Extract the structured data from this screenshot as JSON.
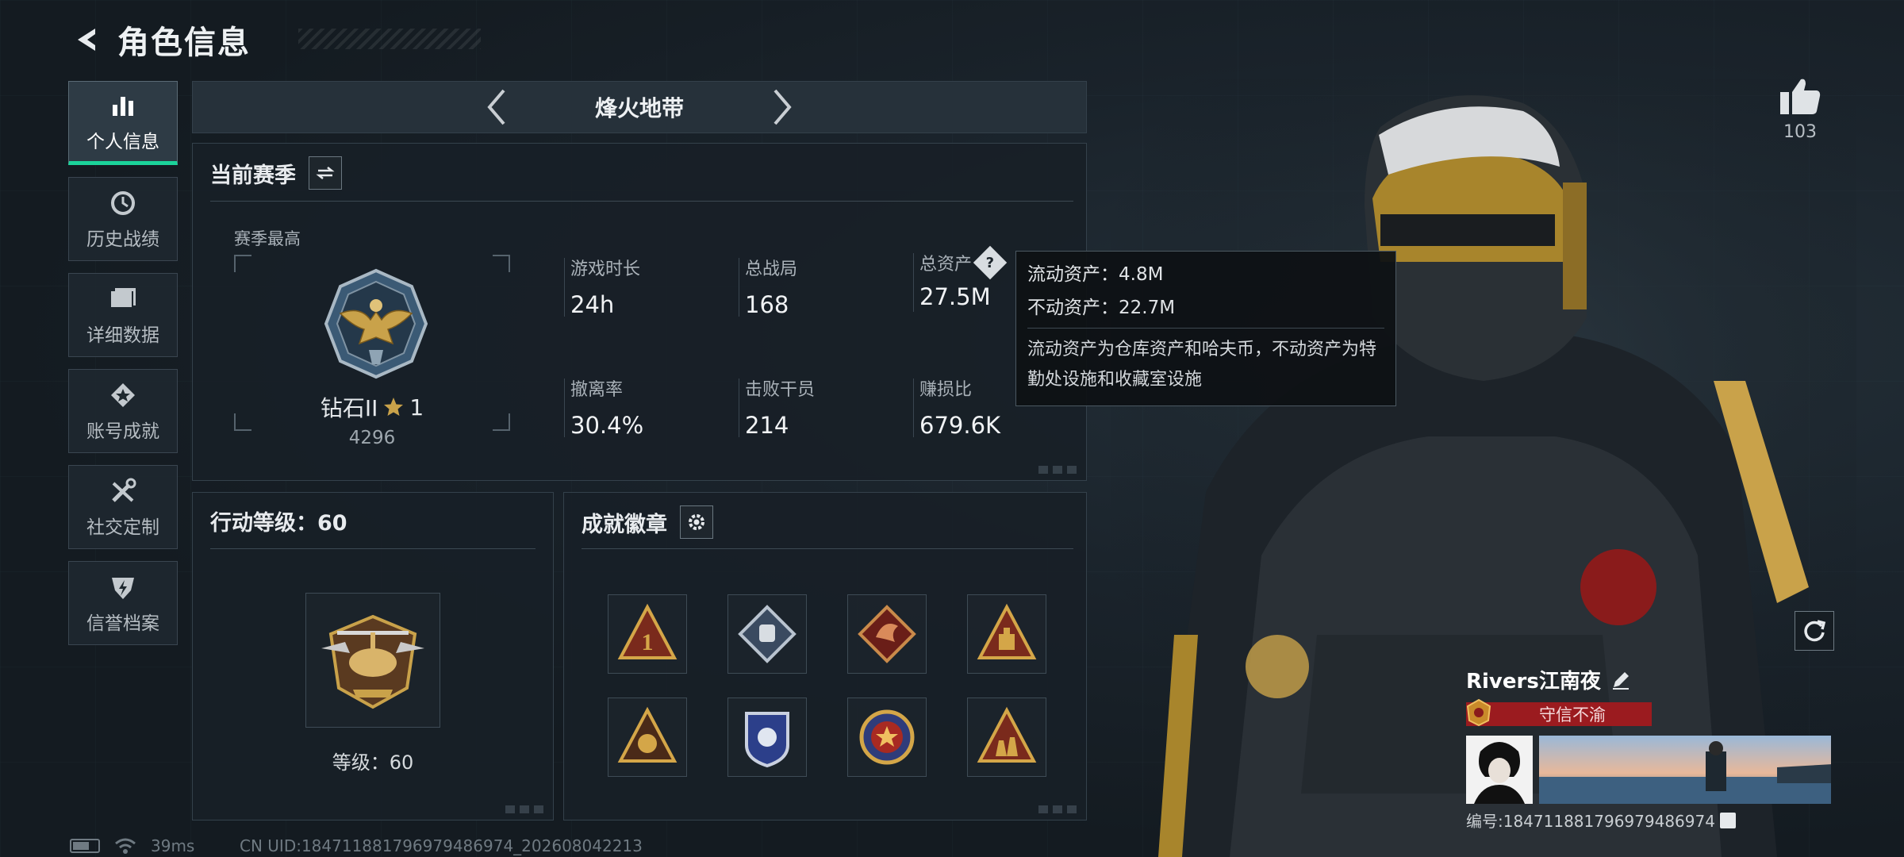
{
  "header": {
    "title": "角色信息"
  },
  "sidebar": {
    "items": [
      {
        "label": "个人信息",
        "icon": "bar-chart-icon",
        "active": true
      },
      {
        "label": "历史战绩",
        "icon": "history-icon"
      },
      {
        "label": "详细数据",
        "icon": "folder-icon"
      },
      {
        "label": "账号成就",
        "icon": "achievement-star-icon"
      },
      {
        "label": "社交定制",
        "icon": "wrench-screwdriver-icon"
      },
      {
        "label": "信誉档案",
        "icon": "shield-emblem-icon"
      }
    ]
  },
  "mode_bar": {
    "label": "烽火地带"
  },
  "season": {
    "title": "当前赛季",
    "best_label": "赛季最高",
    "rank": {
      "name": "钻石II",
      "stars": "1",
      "score": "4296"
    },
    "stats": {
      "play_time": {
        "label": "游戏时长",
        "value": "24h"
      },
      "total_matches": {
        "label": "总战局",
        "value": "168"
      },
      "total_assets": {
        "label": "总资产",
        "value": "27.5M"
      },
      "extract_rate": {
        "label": "撤离率",
        "value": "30.4%"
      },
      "operators_defeated": {
        "label": "击败干员",
        "value": "214"
      },
      "profit_ratio": {
        "label": "赚损比",
        "value": "679.6K"
      }
    }
  },
  "tooltip": {
    "liquid": "流动资产：4.8M",
    "fixed": "不动资产：22.7M",
    "description": "流动资产为仓库资产和哈夫币，不动资产为特勤处设施和收藏室设施"
  },
  "action_level": {
    "title": "行动等级：60",
    "level_text": "等级：60"
  },
  "achievements": {
    "title": "成就徽章",
    "medals": [
      "medal-1",
      "medal-2",
      "medal-3",
      "medal-4",
      "medal-5",
      "medal-6",
      "medal-7",
      "medal-8"
    ]
  },
  "like": {
    "count": "103"
  },
  "player": {
    "name": "Rivers江南夜",
    "title_tag": "守信不渝",
    "uid_line": "编号:18471188179697948697​4"
  },
  "status": {
    "ping": "39ms",
    "uid_footer": "CN UID:18471188179697948697​4_202608042213"
  },
  "colors": {
    "accent": "#1bd39a",
    "title_red": "#9b1b1f",
    "gold": "#c9a24a"
  }
}
